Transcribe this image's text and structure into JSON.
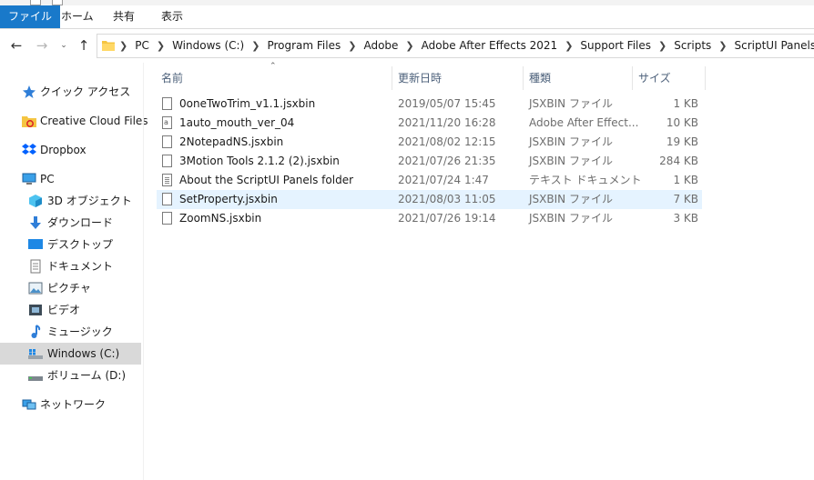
{
  "ribbon": {
    "tabs": [
      "ファイル",
      "ホーム",
      "共有",
      "表示"
    ],
    "accent": "#1979ca"
  },
  "address": {
    "crumbs": [
      "PC",
      "Windows (C:)",
      "Program Files",
      "Adobe",
      "Adobe After Effects 2021",
      "Support Files",
      "Scripts",
      "ScriptUI Panels"
    ]
  },
  "nav": {
    "items": [
      {
        "label": "クイック アクセス",
        "icon": "star-pin-icon"
      },
      {
        "label": "Creative Cloud Files",
        "icon": "creative-cloud-folder-icon"
      },
      {
        "label": "Dropbox",
        "icon": "dropbox-icon"
      },
      {
        "label": "PC",
        "icon": "pc-icon"
      },
      {
        "label": "3D オブジェクト",
        "icon": "3d-objects-icon"
      },
      {
        "label": "ダウンロード",
        "icon": "download-icon"
      },
      {
        "label": "デスクトップ",
        "icon": "desktop-icon"
      },
      {
        "label": "ドキュメント",
        "icon": "documents-icon"
      },
      {
        "label": "ピクチャ",
        "icon": "pictures-icon"
      },
      {
        "label": "ビデオ",
        "icon": "videos-icon"
      },
      {
        "label": "ミュージック",
        "icon": "music-icon"
      },
      {
        "label": "Windows (C:)",
        "icon": "windows-drive-icon"
      },
      {
        "label": "ボリューム (D:)",
        "icon": "drive-icon"
      },
      {
        "label": "ネットワーク",
        "icon": "network-icon"
      }
    ],
    "selected": "Windows (C:)"
  },
  "list": {
    "columns": {
      "name": "名前",
      "date": "更新日時",
      "type": "種類",
      "size": "サイズ"
    },
    "rows": [
      {
        "name": "0oneTwoTrim_v1.1.jsxbin",
        "date": "2019/05/07 15:45",
        "type": "JSXBIN ファイル",
        "size": "1 KB",
        "icon": "file-icon"
      },
      {
        "name": "1auto_mouth_ver_04",
        "date": "2021/11/20 16:28",
        "type": "Adobe After Effect...",
        "size": "10 KB",
        "icon": "ae-script-icon"
      },
      {
        "name": "2NotepadNS.jsxbin",
        "date": "2021/08/02 12:15",
        "type": "JSXBIN ファイル",
        "size": "19 KB",
        "icon": "file-icon"
      },
      {
        "name": "3Motion Tools 2.1.2 (2).jsxbin",
        "date": "2021/07/26 21:35",
        "type": "JSXBIN ファイル",
        "size": "284 KB",
        "icon": "file-icon"
      },
      {
        "name": "About the ScriptUI Panels folder",
        "date": "2021/07/24 1:47",
        "type": "テキスト ドキュメント",
        "size": "1 KB",
        "icon": "text-file-icon"
      },
      {
        "name": "SetProperty.jsxbin",
        "date": "2021/08/03 11:05",
        "type": "JSXBIN ファイル",
        "size": "7 KB",
        "icon": "file-icon"
      },
      {
        "name": "ZoomNS.jsxbin",
        "date": "2021/07/26 19:14",
        "type": "JSXBIN ファイル",
        "size": "3 KB",
        "icon": "file-icon"
      }
    ],
    "selected_row": "SetProperty.jsxbin"
  }
}
